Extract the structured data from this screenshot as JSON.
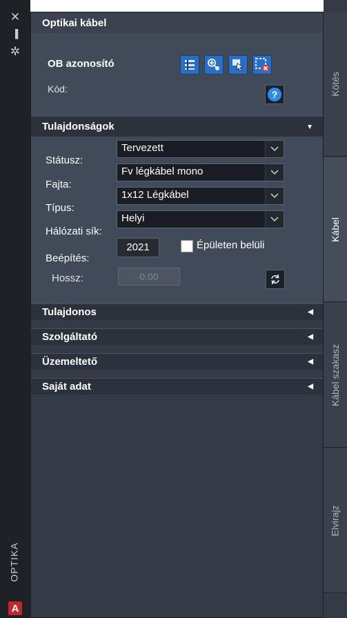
{
  "sidebar": {
    "close_glyph": "✕",
    "pin_glyph": "▐",
    "settings_glyph": "✲",
    "vertical_label": "OPTIKA",
    "app_icon_letter": "A"
  },
  "panel": {
    "title": "Optikai kábel",
    "ob_label": "OB azonosító",
    "kod_label": "Kód:",
    "tool_icons": [
      "cable-list-icon",
      "add-node-icon",
      "select-cursor-icon",
      "delete-selection-icon"
    ],
    "help_glyph": "?"
  },
  "properties": {
    "header": "Tulajdonságok",
    "statusz_label": "Státusz:",
    "statusz_value": "Tervezett",
    "fajta_label": "Fajta:",
    "fajta_value": "Fv légkábel mono",
    "tipus_label": "Típus:",
    "tipus_value": "1x12 Légkábel",
    "halozati_label": "Hálózati sík:",
    "halozati_value": "Helyi",
    "beepites_label": "Beépítés:",
    "beepites_value": "2021",
    "epuleten_label": "Épületen belüli",
    "hossz_label": "Hossz:",
    "hossz_value": "0.00"
  },
  "sections": [
    {
      "label": "Tulajdonos"
    },
    {
      "label": "Szolgáltató"
    },
    {
      "label": "Üzemeltető"
    },
    {
      "label": "Saját adat"
    }
  ],
  "tabs": [
    {
      "label": "Kötés"
    },
    {
      "label": "Kábel"
    },
    {
      "label": "Kábel szakasz"
    },
    {
      "label": "Elvirajz"
    }
  ],
  "colors": {
    "accent": "#2a6fc4",
    "panel_bg": "#343b46",
    "section_bg": "#414a58",
    "dark": "#1e2126"
  }
}
